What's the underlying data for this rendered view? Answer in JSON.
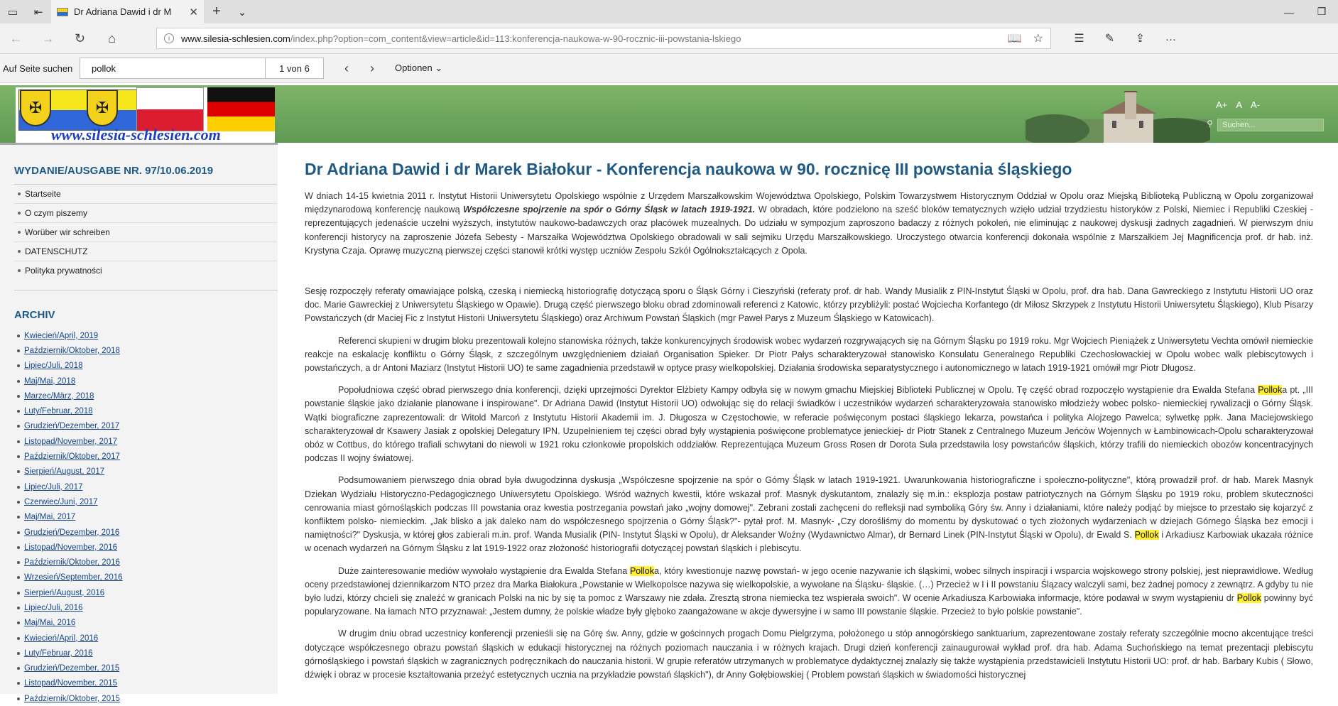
{
  "browser": {
    "tab_title": "Dr Adriana Dawid i dr M",
    "url_domain": "www.silesia-schlesien.com",
    "url_path": "/index.php?option=com_content&view=article&id=113:konferencja-naukowa-w-90-rocznic-iii-powstania-lskiego"
  },
  "findbar": {
    "label": "Auf Seite suchen",
    "query": "pollok",
    "count": "1 von 6",
    "options": "Optionen"
  },
  "header": {
    "site_url": "www.silesia-schlesien.com",
    "font_a_large": "A+",
    "font_a": "A",
    "font_a_small": "A-",
    "search_placeholder": "Suchen..."
  },
  "sidebar": {
    "edition": "WYDANIE/AUSGABE NR. 97/10.06.2019",
    "menu": [
      "Startseite",
      "O czym piszemy",
      "Worüber wir schreiben",
      "DATENSCHUTZ",
      "Polityka prywatności"
    ],
    "archiv_title": "ARCHIV",
    "archive": [
      "Kwiecień/April, 2019",
      "Październik/Oktober, 2018",
      "Lipiec/Juli, 2018",
      "Maj/Mai, 2018",
      "Marzec/März, 2018",
      "Luty/Februar, 2018",
      "Grudzień/Dezember, 2017",
      "Listopad/November, 2017",
      "Październik/Oktober, 2017",
      "Sierpień/August, 2017",
      "Lipiec/Juli, 2017",
      "Czerwiec/Juni, 2017",
      "Maj/Mai, 2017",
      "Grudzień/Dezember, 2016",
      "Listopad/November, 2016",
      "Październik/Oktober, 2016",
      "Wrzesień/September, 2016",
      "Sierpień/August, 2016",
      "Lipiec/Juli, 2016",
      "Maj/Mai, 2016",
      "Kwiecień/April, 2016",
      "Luty/Februar, 2016",
      "Grudzień/Dezember, 2015",
      "Listopad/November, 2015",
      "Październik/Oktober, 2015"
    ]
  },
  "article": {
    "title": "Dr Adriana Dawid i dr Marek Białokur - Konferencja naukowa w 90. rocznicę III powstania śląskiego",
    "p1a": "W dniach 14-15 kwietnia 2011 r. Instytut Historii Uniwersytetu Opolskiego wspólnie z Urzędem Marszałkowskim Województwa Opolskiego, Polskim Towarzystwem Historycznym Oddział w Opolu oraz Miejską Biblioteką Publiczną w Opolu zorganizował międzynarodową konferencję naukową ",
    "p1b": "Współczesne spojrzenie na spór o Górny Śląsk w latach 1919-1921.",
    "p1c": " W obradach, które podzielono na sześć bloków tematycznych wzięło udział trzydziestu historyków z Polski, Niemiec i Republiki Czeskiej - reprezentujących jedenaście uczelni wyższych, instytutów naukowo-badawczych oraz placówek muzealnych. Do udziału w sympozjum zaproszono badaczy z różnych pokoleń, nie eliminując z naukowej dyskusji żadnych zagadnień. W pierwszym dniu konferencji historycy na zaproszenie Józefa Sebesty - Marszałka Województwa Opolskiego obradowali w sali sejmiku Urzędu Marszałkowskiego. Uroczystego otwarcia konferencji dokonała wspólnie z Marszałkiem Jej Magnificencja prof. dr hab. inż. Krystyna Czaja. Oprawę muzyczną pierwszej części stanowił krótki występ uczniów Zespołu Szkół Ogólnokształcących z Opola.",
    "p2": "Sesję rozpoczęły referaty omawiające polską, czeską i niemiecką historiografię dotyczącą sporu o Śląsk Górny i Cieszyński (referaty prof. dr hab. Wandy Musialik z PIN-Instytut Śląski w Opolu, prof. dra hab. Dana Gawreckiego z Instytutu Historii UO oraz doc. Marie Gawreckiej z Uniwersytetu Śląskiego w Opawie). Drugą część pierwszego bloku obrad zdominowali referenci z Katowic, którzy przybliżyli: postać Wojciecha Korfantego (dr Miłosz Skrzypek z Instytutu Historii Uniwersytetu Śląskiego), Klub Pisarzy Powstańczych (dr Maciej Fic z Instytut Historii Uniwersytetu Śląskiego) oraz Archiwum Powstań Śląskich (mgr Paweł Parys z Muzeum Śląskiego w Katowicach).",
    "p3": "Referenci skupieni w drugim bloku prezentowali kolejno stanowiska różnych, także konkurencyjnych środowisk wobec wydarzeń rozgrywających się na Górnym Śląsku po 1919 roku. Mgr Wojciech Pieniążek z Uniwersytetu Vechta omówił niemieckie reakcje na eskalację konfliktu o Górny Śląsk, z szczególnym uwzględnieniem działań Organisation Spieker. Dr Piotr Pałys scharakteryzował stanowisko Konsulatu Generalnego Republiki Czechosłowackiej w Opolu wobec walk plebiscytowych i powstańczych, a dr Antoni Maziarz (Instytut Historii UO) te same zagadnienia przedstawił w optyce prasy wielkopolskiej. Działania środowiska separatystycznego i autonomicznego w latach 1919-1921 omówił mgr Piotr Długosz.",
    "p4a": "Popołudniowa część obrad pierwszego dnia konferencji, dzięki uprzejmości Dyrektor Elżbiety Kampy odbyła się w nowym gmachu Miejskiej Biblioteki Publicznej w Opolu. Tę część obrad rozpoczęło wystąpienie dra Ewalda Stefana ",
    "p4_hl": "Pollok",
    "p4b": "a pt. „III powstanie śląskie jako działanie planowane i inspirowane\". Dr Adriana Dawid (Instytut Historii UO) odwołując się do relacji świadków i uczestników wydarzeń scharakteryzowała stanowisko młodzieży wobec polsko- niemieckiej rywalizacji o Górny Śląsk. Wątki biograficzne zaprezentowali: dr Witold Marcoń z Instytutu Historii Akademii im. J. Długosza w Częstochowie, w referacie poświęconym postaci śląskiego lekarza, powstańca i polityka Alojzego Pawelca; sylwetkę ppłk. Jana Maciejowskiego scharakteryzował dr Ksawery Jasiak z opolskiej Delegatury IPN. Uzupełnieniem tej części obrad były wystąpienia poświęcone problematyce jenieckiej- dr Piotr Stanek z Centralnego Muzeum Jeńców Wojennych w Łambinowicach-Opolu scharakteryzował obóz w Cottbus, do którego trafiali schwytani do niewoli w 1921 roku członkowie propolskich oddziałów. Reprezentująca Muzeum Gross Rosen dr Dorota Sula przedstawiła losy powstańców śląskich, którzy trafili do niemieckich obozów koncentracyjnych podczas II wojny światowej.",
    "p5a": "Podsumowaniem pierwszego dnia obrad była dwugodzinna dyskusja „Współczesne spojrzenie na spór o Górny Śląsk w latach 1919-1921. Uwarunkowania historiograficzne i społeczno-polityczne\", którą prowadził prof. dr hab. Marek Masnyk Dziekan Wydziału Historyczno-Pedagogicznego Uniwersytetu Opolskiego. Wśród ważnych kwestii, które wskazał prof. Masnyk dyskutantom, znalazły się m.in.: eksplozja postaw patriotycznych na Górnym Śląsku po 1919 roku, problem skuteczności cenrowania miast górnośląskich podczas III powstania oraz kwestia postrzegania powstań jako „wojny domowej\". Zebrani zostali zachęceni do refleksji nad symboliką Góry św. Anny i działaniami, które należy podjąć by miejsce to przestało się kojarzyć z konfliktem polsko- niemieckim. „Jak blisko a jak daleko nam do współczesnego spojrzenia o Górny Śląsk?\"- pytał prof. M. Masnyk- „Czy dorośliśmy do momentu by dyskutować o tych złożonych wydarzeniach w dziejach Górnego Śląska bez emocji i namiętności?\" Dyskusja, w której głos zabierali m.in. prof. Wanda Musialik (PIN- Instytut Śląski w Opolu), dr Aleksander Woźny (Wydawnictwo Almar), dr Bernard Linek (PIN-Instytut Śląski w Opolu), dr Ewald S. ",
    "p5_hl": "Pollok",
    "p5b": " i Arkadiusz Karbowiak ukazała różnice w ocenach wydarzeń na Górnym Śląsku z lat 1919-1922 oraz złożoność historiografii dotyczącej powstań śląskich i plebiscytu.",
    "p6a": "Duże zainteresowanie mediów wywołało wystąpienie dra Ewalda Stefana ",
    "p6_hl1": "Pollok",
    "p6b": "a, który kwestionuje nazwę powstań- w jego ocenie nazywanie ich śląskimi, wobec silnych inspiracji i wsparcia wojskowego strony polskiej, jest nieprawidłowe. Według oceny przedstawionej dziennikarzom NTO przez dra Marka Białokura „Powstanie w Wielkopolsce nazywa się wielkopolskie, a wywołane na Śląsku- śląskie. (…) Przecież w I i II powstaniu Ślązacy walczyli sami, bez żadnej pomocy z zewnątrz. A gdyby tu nie było ludzi, którzy chcieli się znaleźć w granicach Polski na nic by się ta pomoc z Warszawy nie zdała. Zresztą strona niemiecka tez wspierała swoich\". W ocenie Arkadiusza Karbowiaka informacje, które podawał w swym wystąpieniu dr ",
    "p6_hl2": "Pollok",
    "p6c": " powinny być popularyzowane. Na łamach NTO przyznawał: „Jestem dumny, że polskie władze były głęboko zaangażowane w akcje dywersyjne i w samo III powstanie śląskie. Przecież to było polskie powstanie\".",
    "p7": "W drugim dniu obrad uczestnicy konferencji przenieśli się na Górę św. Anny, gdzie w gościnnych progach Domu Pielgrzyma, położonego u stóp annogórskiego sanktuarium, zaprezentowane zostały referaty szczególnie mocno akcentujące treści dotyczące współczesnego obrazu powstań śląskich w edukacji historycznej na różnych poziomach nauczania i w różnych krajach. Drugi dzień konferencji zainaugurował wykład prof. dra hab. Adama Suchońskiego na temat prezentacji plebiscytu górnośląskiego i powstań śląskich w zagranicznych podręcznikach do nauczania historii. W grupie referatów utrzymanych w problematyce dydaktycznej znalazły się także wystąpienia przedstawicieli Instytutu Historii UO: prof. dr hab. Barbary Kubis ( Słowo, dźwięk i obraz w procesie kształtowania przeżyć estetycznych ucznia na przykładzie powstań śląskich\"), dr Anny Gołębiowskiej ( Problem powstań śląskich w świadomości historycznej"
  }
}
